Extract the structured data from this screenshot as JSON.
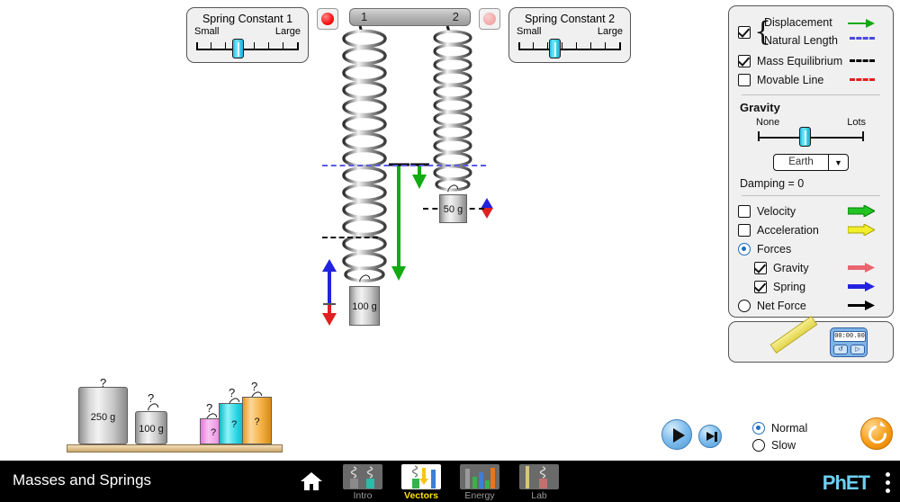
{
  "sim": {
    "title": "Masses and Springs",
    "logo": "PhET",
    "home_icon": "home-icon",
    "menu_icon": "kebab-menu-icon"
  },
  "tabs": [
    {
      "label": "Intro",
      "active": false
    },
    {
      "label": "Vectors",
      "active": true
    },
    {
      "label": "Energy",
      "active": false
    },
    {
      "label": "Lab",
      "active": false
    }
  ],
  "spring_constant_1": {
    "title": "Spring Constant 1",
    "min_label": "Small",
    "max_label": "Large",
    "value_pct": 40
  },
  "spring_constant_2": {
    "title": "Spring Constant 2",
    "min_label": "Small",
    "max_label": "Large",
    "value_pct": 34
  },
  "springs": {
    "bar_label_1": "1",
    "bar_label_2": "2",
    "grab_button_1": "red-circle-icon",
    "grab_button_2": "red-circle-icon-faded"
  },
  "indicators": {
    "displacement": {
      "label": "Displacement",
      "checked": true,
      "legend": "green-arrow-icon",
      "color": "#12aa12"
    },
    "natural_length": {
      "label": "Natural Length",
      "checked": true,
      "legend": "blue-dashed-line-icon",
      "color": "#4a4ae0"
    },
    "mass_equilibrium": {
      "label": "Mass Equilibrium",
      "checked": true,
      "legend": "black-dashed-line-icon",
      "color": "#000000"
    },
    "movable_line": {
      "label": "Movable Line",
      "checked": false,
      "legend": "red-dashed-line-icon",
      "color": "#e02020"
    }
  },
  "gravity": {
    "title": "Gravity",
    "min_label": "None",
    "max_label": "Lots",
    "value_pct": 44,
    "body": "Earth",
    "damping": "Damping = 0"
  },
  "vectors": {
    "velocity": {
      "label": "Velocity",
      "checked": false,
      "color": "#22c422"
    },
    "acceleration": {
      "label": "Acceleration",
      "checked": false,
      "color": "#f2ef2a"
    },
    "forces": {
      "label": "Forces",
      "selected": true
    },
    "gravity_force": {
      "label": "Gravity",
      "checked": true,
      "color": "#e9666e"
    },
    "spring_force": {
      "label": "Spring",
      "checked": true,
      "color": "#2222e0"
    },
    "net_force": {
      "label": "Net Force",
      "selected": false,
      "color": "#000000"
    }
  },
  "toolbox": {
    "ruler": "ruler-icon",
    "stopwatch_time": "00:00.00",
    "stopwatch_reset": "↺",
    "stopwatch_play": "▷"
  },
  "playback": {
    "play": "play-icon",
    "step": "step-forward-icon",
    "normal": "Normal",
    "slow": "Slow",
    "speed_selected": "Normal",
    "reset": "reset-all-icon"
  },
  "hanging_masses": [
    {
      "label": "100 g",
      "spring": 1
    },
    {
      "label": "50 g",
      "spring": 2
    }
  ],
  "shelf_masses": [
    {
      "label": "250 g",
      "color": "gray",
      "hook": "?"
    },
    {
      "label": "100 g",
      "color": "gray",
      "hook": "?"
    },
    {
      "label": "?",
      "color": "#f0a0e8",
      "hook": "?"
    },
    {
      "label": "?",
      "color": "#22d3e0",
      "hook": "?"
    },
    {
      "label": "?",
      "color": "#f6b44a",
      "hook": "?"
    }
  ]
}
